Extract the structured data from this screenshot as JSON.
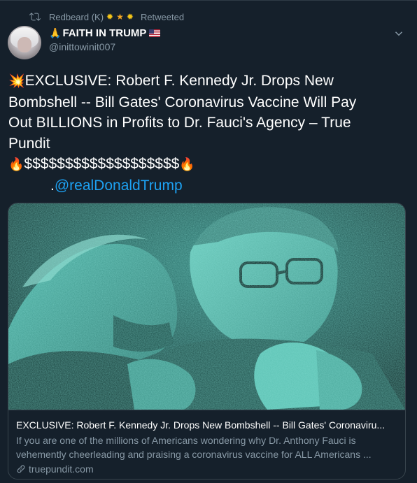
{
  "retweet": {
    "icon": "retweet-icon",
    "user": "Redbeard (K)",
    "emoji": [
      "sun",
      "star",
      "sun"
    ],
    "label": "Retweeted"
  },
  "author": {
    "display_name": "FAITH IN TRUMP",
    "handle": "@inittowinit007",
    "name_emoji_before": "pray",
    "name_emoji_after": "us-flag"
  },
  "tweet": {
    "line1_emoji": "collision",
    "line1": "EXCLUSIVE: Robert F. Kennedy Jr. Drops New",
    "line2": "Bombshell -- Bill Gates' Coronavirus Vaccine Will Pay",
    "line3": "Out BILLIONS in Profits to Dr. Fauci's Agency – True",
    "line4": "Pundit",
    "line5_emoji": "fire",
    "line5": "$$$$$$$$$$$$$$$$$$$",
    "mention_prefix": ".",
    "mention": "@realDonaldTrump"
  },
  "card": {
    "image_description": "two men seated, teal-toned photo",
    "title": "EXCLUSIVE: Robert F. Kennedy Jr. Drops New Bombshell -- Bill Gates' Coronaviru...",
    "description": "If you are one of the millions of Americans wondering why Dr. Anthony Fauci is vehemently cheerleading and praising a coronavirus vaccine for ALL Americans ...",
    "domain": "truepundit.com",
    "domain_icon": "link-icon"
  },
  "colors": {
    "background": "#15202b",
    "text": "#ffffff",
    "muted": "#8899a6",
    "link": "#1da1f2",
    "border": "#38444d",
    "image_tint": "#3aa89a"
  }
}
